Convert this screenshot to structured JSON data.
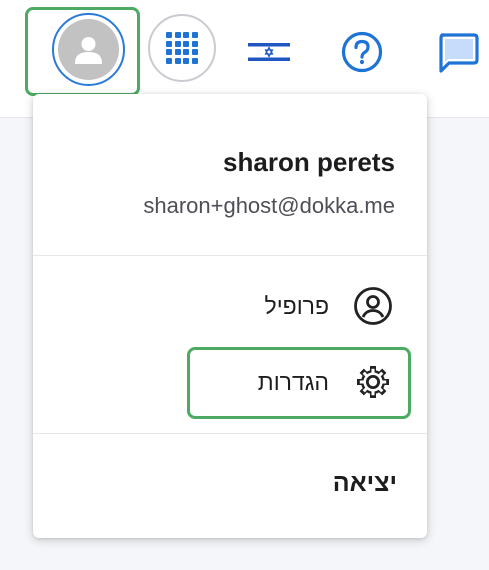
{
  "header": {
    "avatar_icon": "user-avatar-icon",
    "apps_icon": "apps-grid-icon",
    "language_icon": "israel-flag-icon",
    "help_icon": "help-circle-icon",
    "chat_icon": "chat-bubble-icon"
  },
  "user_menu": {
    "name": "sharon perets",
    "email": "sharon+ghost@dokka.me",
    "items": [
      {
        "label": "פרופיל",
        "icon": "profile-circle-icon"
      },
      {
        "label": "הגדרות",
        "icon": "gear-icon"
      }
    ],
    "logout_label": "יציאה"
  },
  "colors": {
    "accent_blue": "#1e73d7",
    "highlight_green": "#4caa62",
    "avatar_gray": "#c2c2c2"
  }
}
